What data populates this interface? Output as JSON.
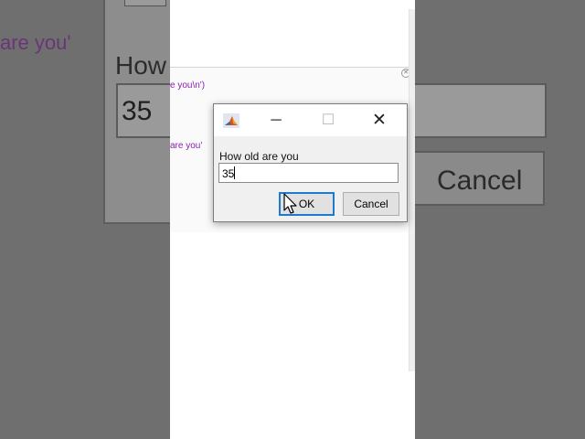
{
  "background": {
    "left_code_fragment": "are you'",
    "left_prompt_fragment": "How",
    "left_input_fragment": "35",
    "right_cancel_fragment": "Cancel"
  },
  "editor": {
    "line1": "e you\\n')",
    "line2": "are you'"
  },
  "dialog": {
    "title": "",
    "prompt": "How old are you",
    "answer": "35",
    "ok_label": "OK",
    "cancel_label": "Cancel",
    "minimize_symbol": "─",
    "maximize_symbol": "☐",
    "close_symbol": "✕"
  },
  "colors": {
    "code_string": "#8a1fb0",
    "ok_focus": "#1f79d1"
  },
  "icons": [
    "matlab-app-icon",
    "minimize-icon",
    "maximize-icon",
    "close-icon",
    "mouse-pointer-icon"
  ]
}
